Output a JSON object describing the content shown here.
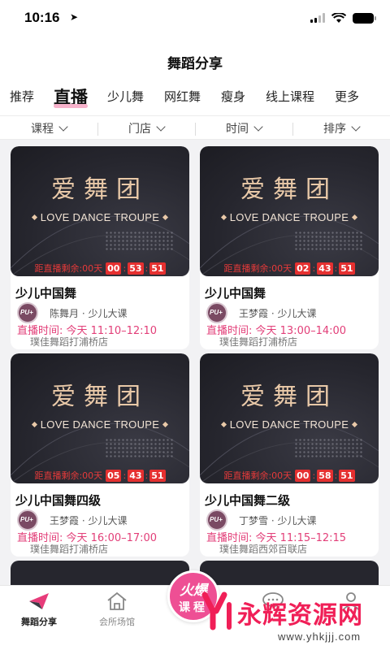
{
  "status_bar": {
    "time": "10:16"
  },
  "header": {
    "title": "舞蹈分享"
  },
  "tabs": [
    {
      "label": "推荐",
      "active": false
    },
    {
      "label": "直播",
      "active": true
    },
    {
      "label": "少儿舞",
      "active": false
    },
    {
      "label": "网红舞",
      "active": false
    },
    {
      "label": "瘦身",
      "active": false
    },
    {
      "label": "线上课程",
      "active": false
    },
    {
      "label": "更多",
      "active": false
    }
  ],
  "filters": [
    {
      "label": "课程"
    },
    {
      "label": "门店"
    },
    {
      "label": "时间"
    },
    {
      "label": "排序"
    }
  ],
  "cards": [
    {
      "cover_title": "爱舞团",
      "cover_subtitle": "LOVE DANCE TROUPE",
      "countdown_label": "距直播剩余:00天",
      "countdown": [
        "00",
        "53",
        "51"
      ],
      "title": "少儿中国舞",
      "avatar_text": "PU+",
      "meta": "陈舞月 · 少儿大课",
      "live_time": "直播时间: 今天  11:10–12:10",
      "store": "璞佳舞蹈打浦桥店"
    },
    {
      "cover_title": "爱舞团",
      "cover_subtitle": "LOVE DANCE TROUPE",
      "countdown_label": "距直播剩余:00天",
      "countdown": [
        "02",
        "43",
        "51"
      ],
      "title": "少儿中国舞",
      "avatar_text": "PU+",
      "meta": "王梦霞 · 少儿大课",
      "live_time": "直播时间: 今天  13:00–14:00",
      "store": "璞佳舞蹈打浦桥店"
    },
    {
      "cover_title": "爱舞团",
      "cover_subtitle": "LOVE DANCE TROUPE",
      "countdown_label": "距直播剩余:00天",
      "countdown": [
        "05",
        "43",
        "51"
      ],
      "title": "少儿中国舞四级",
      "avatar_text": "PU+",
      "meta": "王梦霞 · 少儿大课",
      "live_time": "直播时间: 今天  16:00–17:00",
      "store": "璞佳舞蹈打浦桥店"
    },
    {
      "cover_title": "爱舞团",
      "cover_subtitle": "LOVE DANCE TROUPE",
      "countdown_label": "距直播剩余:00天",
      "countdown": [
        "00",
        "58",
        "51"
      ],
      "title": "少儿中国舞二级",
      "avatar_text": "PU+",
      "meta": "丁梦雪 · 少儿大课",
      "live_time": "直播时间: 今天  11:15–12:15",
      "store": "璞佳舞蹈西郊百联店"
    }
  ],
  "center_button": {
    "top": "火爆",
    "bottom": "课程"
  },
  "tabbar": [
    {
      "label": "舞蹈分享",
      "icon": "paper-plane-icon",
      "active": true
    },
    {
      "label": "会所场馆",
      "icon": "house-icon",
      "active": false
    },
    {
      "label": "",
      "icon": "chat-bubble-icon",
      "active": false
    },
    {
      "label": "",
      "icon": "person-icon",
      "active": false
    }
  ],
  "watermark": {
    "text": "永辉资源网",
    "url": "www.yhkjjj.com"
  },
  "colors": {
    "accent_pink": "#ee4f94",
    "live_time_pink": "#e23e78",
    "countdown_red": "#e53030",
    "cover_gold": "#e9c9a8"
  }
}
